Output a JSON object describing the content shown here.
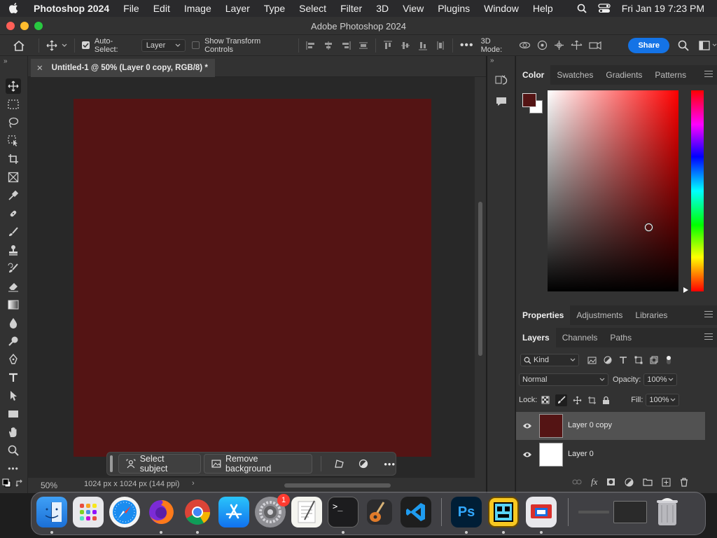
{
  "menubar": {
    "app_name": "Photoshop 2024",
    "menus": [
      "File",
      "Edit",
      "Image",
      "Layer",
      "Type",
      "Select",
      "Filter",
      "3D",
      "View",
      "Plugins",
      "Window",
      "Help"
    ],
    "clock": "Fri Jan 19  7:23 PM"
  },
  "window": {
    "title": "Adobe Photoshop 2024"
  },
  "options_bar": {
    "auto_select_label": "Auto-Select:",
    "auto_select_value": "Layer",
    "transform_label": "Show Transform Controls",
    "mode_3d_label": "3D Mode:",
    "share_label": "Share"
  },
  "document": {
    "tab_title": "Untitled-1 @ 50% (Layer 0 copy, RGB/8) *",
    "zoom": "50%",
    "doc_info": "1024 px x 1024 px (144 ppi)",
    "canvas_color": "#541414"
  },
  "taskbar": {
    "select_subject": "Select subject",
    "remove_background": "Remove background"
  },
  "color_panel": {
    "tabs": [
      "Color",
      "Swatches",
      "Gradients",
      "Patterns"
    ],
    "foreground": "#541414",
    "background": "#ffffff"
  },
  "properties_panel": {
    "tabs": [
      "Properties",
      "Adjustments",
      "Libraries"
    ]
  },
  "layers_panel": {
    "tabs": [
      "Layers",
      "Channels",
      "Paths"
    ],
    "filter_kind": "Kind",
    "blend_mode": "Normal",
    "opacity_label": "Opacity:",
    "opacity_value": "100%",
    "lock_label": "Lock:",
    "fill_label": "Fill:",
    "fill_value": "100%",
    "layers": [
      {
        "name": "Layer 0 copy",
        "thumb": "#541414",
        "selected": true
      },
      {
        "name": "Layer 0",
        "thumb": "#ffffff",
        "selected": false
      }
    ]
  },
  "dock": {
    "settings_badge": "1"
  }
}
